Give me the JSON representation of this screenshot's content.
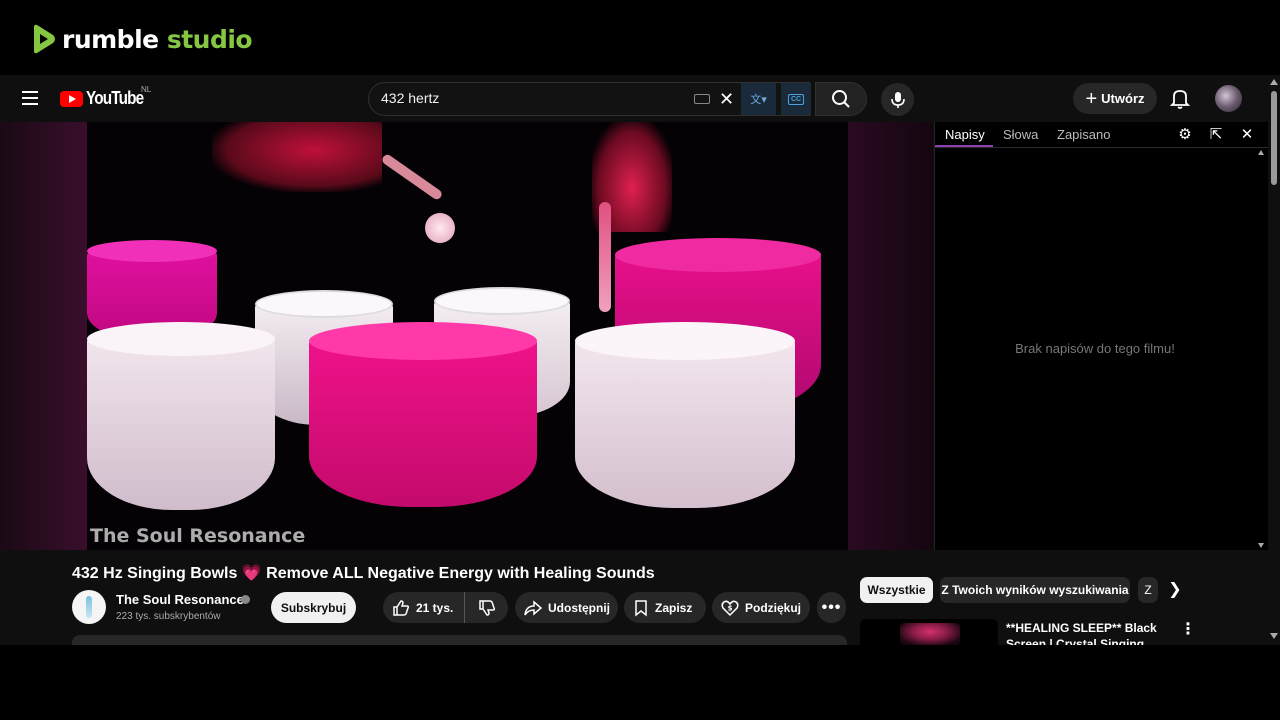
{
  "rumble": {
    "word1": "rumble",
    "word2": "studio"
  },
  "masthead": {
    "logo_text": "YouTube",
    "country_code": "NL",
    "search_value": "432 hertz",
    "create_label": "Utwórz"
  },
  "player": {
    "watermark": "The Soul Resonance"
  },
  "transcript_panel": {
    "tabs": [
      "Napisy",
      "Słowa",
      "Zapisano"
    ],
    "active_tab": "Napisy",
    "empty_message": "Brak napisów do tego filmu!"
  },
  "video": {
    "title": "432 Hz Singing Bowls 💗 Remove ALL Negative Energy with Healing Sounds",
    "channel_name": "The Soul Resonance",
    "subscribers": "223 tys. subskrybentów",
    "subscribe_label": "Subskrybuj",
    "likes": "21 tys.",
    "share_label": "Udostępnij",
    "save_label": "Zapisz",
    "thanks_label": "Podziękuj"
  },
  "related": {
    "chips": [
      "Wszystkie",
      "Z Twoich wyników wyszukiwania",
      "Z"
    ],
    "first_video_title": "**HEALING SLEEP** Black Screen | Crystal Singing Bowls"
  },
  "colors": {
    "rumble_green": "#85c742",
    "yt_red": "#ff0000",
    "panel_active_tab": "#8c3fb0",
    "bowl_magenta": "#e0107a"
  },
  "icons": [
    "menu-icon",
    "keyboard-icon",
    "clear-icon",
    "translate-icon",
    "captions-icon",
    "search-icon",
    "mic-icon",
    "plus-icon",
    "bell-icon",
    "gear-icon",
    "popout-icon",
    "close-icon",
    "verified-icon",
    "like-icon",
    "dislike-icon",
    "share-icon",
    "save-icon",
    "thanks-icon",
    "more-icon",
    "chevron-right-icon"
  ]
}
